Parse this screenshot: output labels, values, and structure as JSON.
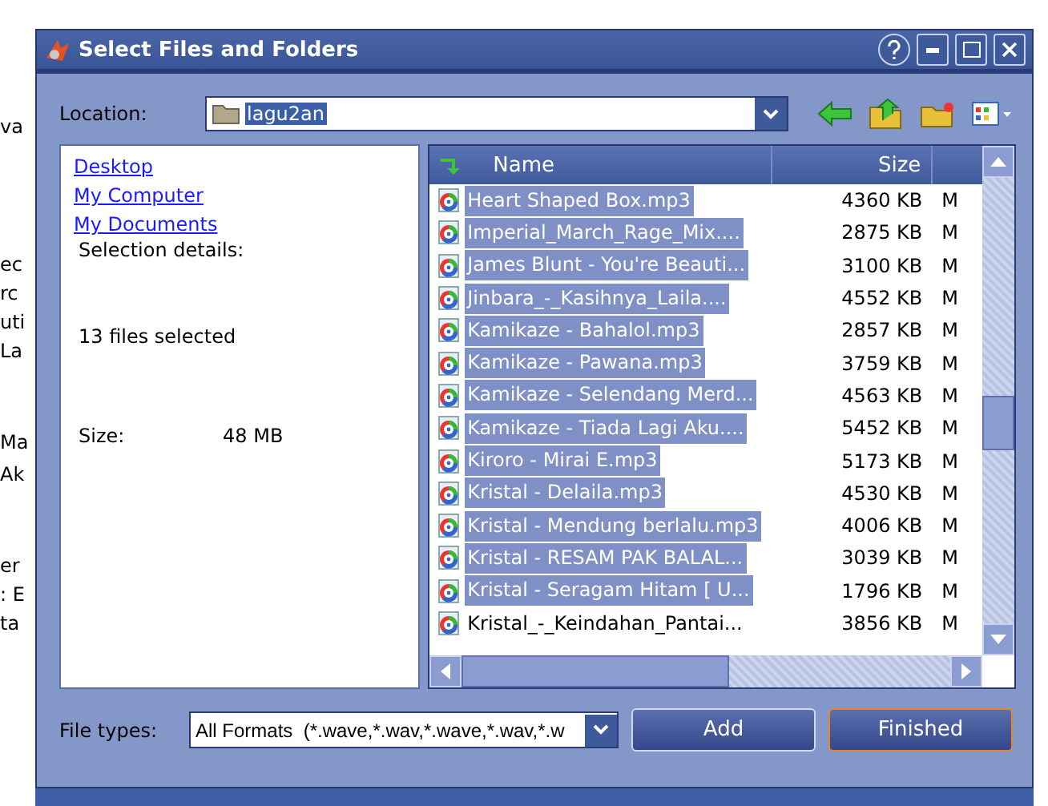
{
  "background_fragments": [
    "va",
    "ec",
    "rc",
    "uti",
    "La",
    "Ma",
    "Ak",
    "er",
    ": E",
    "ta"
  ],
  "window": {
    "title": "Select Files and Folders"
  },
  "location": {
    "label": "Location:",
    "value": "lagu2an"
  },
  "places": [
    "Desktop",
    "My Computer",
    "My Documents"
  ],
  "selection_details": {
    "heading": "Selection details:",
    "count": "13 files selected",
    "size_label": "Size:",
    "size_value": "48 MB"
  },
  "file_list": {
    "columns": [
      "Name",
      "Size"
    ],
    "rows": [
      {
        "name": "Heart Shaped Box.mp3",
        "size": "4360 KB",
        "column_3": "M",
        "selected": true
      },
      {
        "name": "Imperial_March_Rage_Mix....",
        "size": "2875 KB",
        "column_3": "M",
        "selected": true
      },
      {
        "name": "James Blunt - You're Beauti...",
        "size": "3100 KB",
        "column_3": "M",
        "selected": true
      },
      {
        "name": "Jinbara_-_Kasihnya_Laila....",
        "size": "4552 KB",
        "column_3": "M",
        "selected": true
      },
      {
        "name": "Kamikaze - Bahalol.mp3",
        "size": "2857 KB",
        "column_3": "M",
        "selected": true
      },
      {
        "name": "Kamikaze - Pawana.mp3",
        "size": "3759 KB",
        "column_3": "M",
        "selected": true
      },
      {
        "name": "Kamikaze - Selendang Merd...",
        "size": "4563 KB",
        "column_3": "M",
        "selected": true
      },
      {
        "name": "Kamikaze - Tiada Lagi Aku....",
        "size": "5452 KB",
        "column_3": "M",
        "selected": true
      },
      {
        "name": "Kiroro - Mirai E.mp3",
        "size": "5173 KB",
        "column_3": "M",
        "selected": true
      },
      {
        "name": "Kristal - Delaila.mp3",
        "size": "4530 KB",
        "column_3": "M",
        "selected": true
      },
      {
        "name": "Kristal - Mendung berlalu.mp3",
        "size": "4006 KB",
        "column_3": "M",
        "selected": true
      },
      {
        "name": "Kristal - RESAM PAK BALAL...",
        "size": "3039 KB",
        "column_3": "M",
        "selected": true
      },
      {
        "name": "Kristal - Seragam Hitam [ U...",
        "size": "1796 KB",
        "column_3": "M",
        "selected": true
      },
      {
        "name": "Kristal_-_Keindahan_Pantai...",
        "size": "3856 KB",
        "column_3": "M",
        "selected": false
      }
    ]
  },
  "file_types": {
    "label": "File types:",
    "value": "All Formats  (*.wave,*.wav,*.wave,*.wav,*.w"
  },
  "buttons": [
    {
      "label": "Add",
      "focused": false
    },
    {
      "label": "Finished",
      "focused": true
    }
  ]
}
